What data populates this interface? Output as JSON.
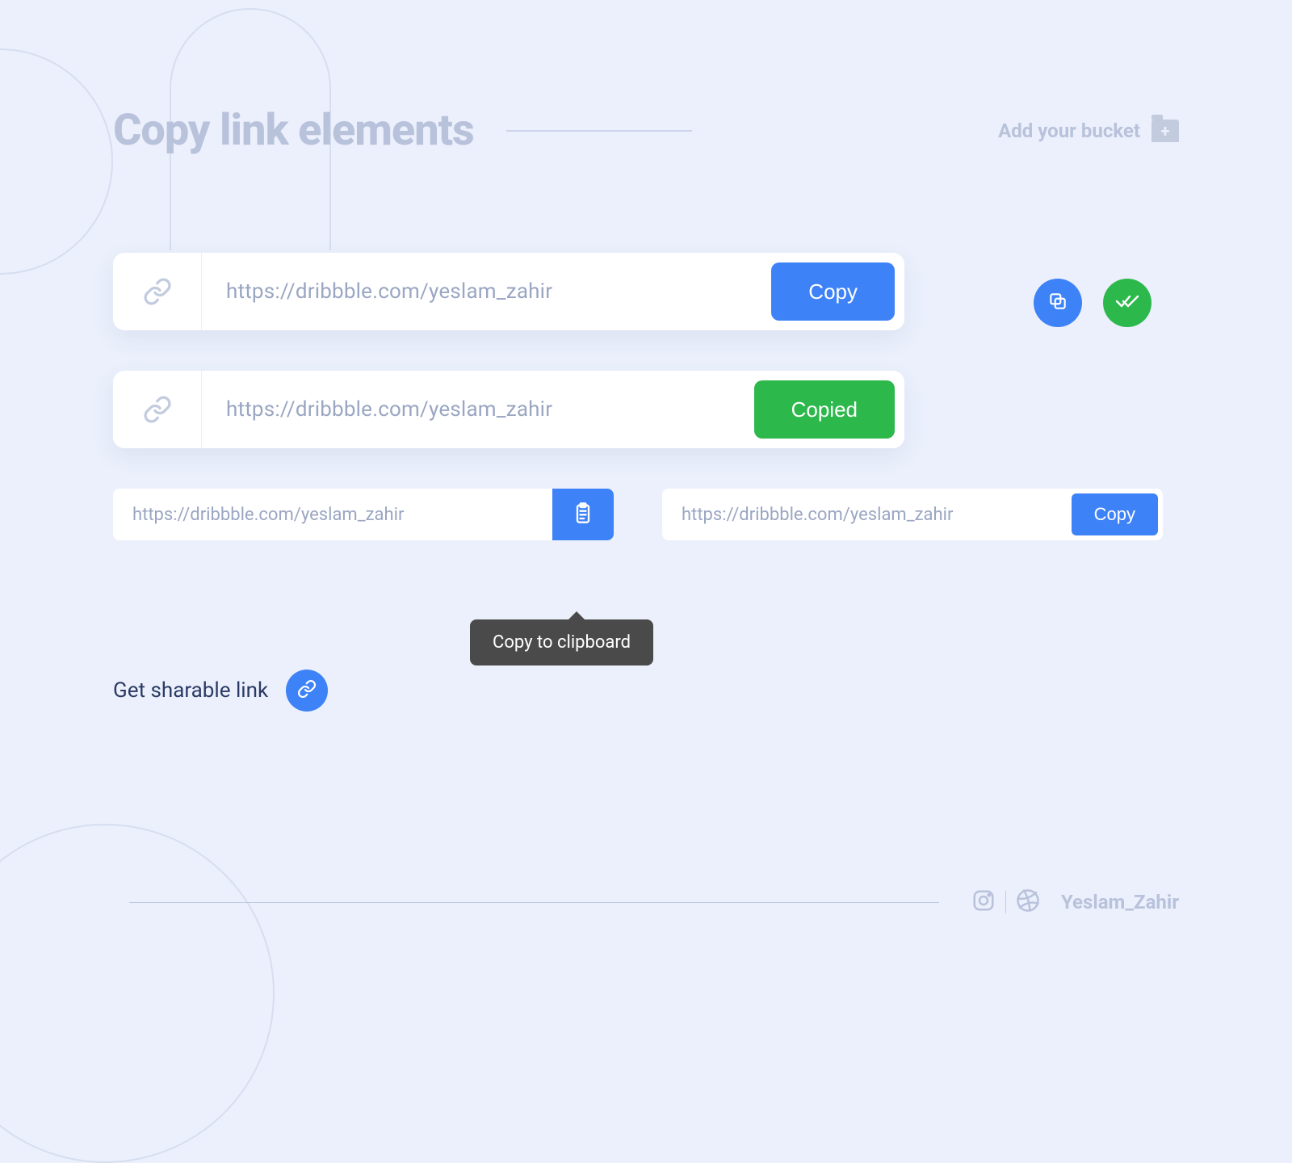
{
  "header": {
    "title": "Copy link elements",
    "bucket_label": "Add your bucket"
  },
  "rows": {
    "url": "https://dribbble.com/yeslam_zahir",
    "copy_label": "Copy",
    "copied_label": "Copied"
  },
  "small": {
    "url_a": "https://dribbble.com/yeslam_zahir",
    "url_b": "https://dribbble.com/yeslam_zahir",
    "copy_label": "Copy",
    "tooltip": "Copy to clipboard"
  },
  "sharable": {
    "label": "Get sharable link"
  },
  "footer": {
    "name": "Yeslam_Zahir"
  },
  "colors": {
    "blue": "#3E82F7",
    "green": "#2DB84C",
    "bg": "#EBF0FC",
    "muted": "#B8C2DB"
  }
}
